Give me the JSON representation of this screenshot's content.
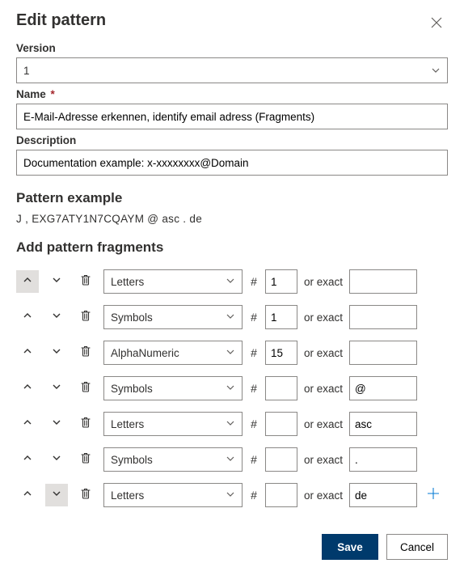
{
  "title": "Edit pattern",
  "labels": {
    "version": "Version",
    "name": "Name",
    "description": "Description",
    "pattern_example": "Pattern example",
    "add_fragments": "Add pattern fragments",
    "hash": "#",
    "or_exact": "or exact",
    "required_mark": "*"
  },
  "fields": {
    "version": "1",
    "name": "E-Mail-Adresse erkennen, identify email adress (Fragments)",
    "description": "Documentation example: x-xxxxxxxx@Domain"
  },
  "pattern_example_text": "J , EXG7ATY1N7CQAYM @ asc . de",
  "fragments": [
    {
      "type": "Letters",
      "count": "1",
      "exact": "",
      "up_selected": true,
      "down_selected": false,
      "show_add": false
    },
    {
      "type": "Symbols",
      "count": "1",
      "exact": "",
      "up_selected": false,
      "down_selected": false,
      "show_add": false
    },
    {
      "type": "AlphaNumeric",
      "count": "15",
      "exact": "",
      "up_selected": false,
      "down_selected": false,
      "show_add": false
    },
    {
      "type": "Symbols",
      "count": "",
      "exact": "@",
      "up_selected": false,
      "down_selected": false,
      "show_add": false
    },
    {
      "type": "Letters",
      "count": "",
      "exact": "asc",
      "up_selected": false,
      "down_selected": false,
      "show_add": false
    },
    {
      "type": "Symbols",
      "count": "",
      "exact": ".",
      "up_selected": false,
      "down_selected": false,
      "show_add": false
    },
    {
      "type": "Letters",
      "count": "",
      "exact": "de",
      "up_selected": false,
      "down_selected": true,
      "show_add": true
    }
  ],
  "buttons": {
    "save": "Save",
    "cancel": "Cancel"
  }
}
